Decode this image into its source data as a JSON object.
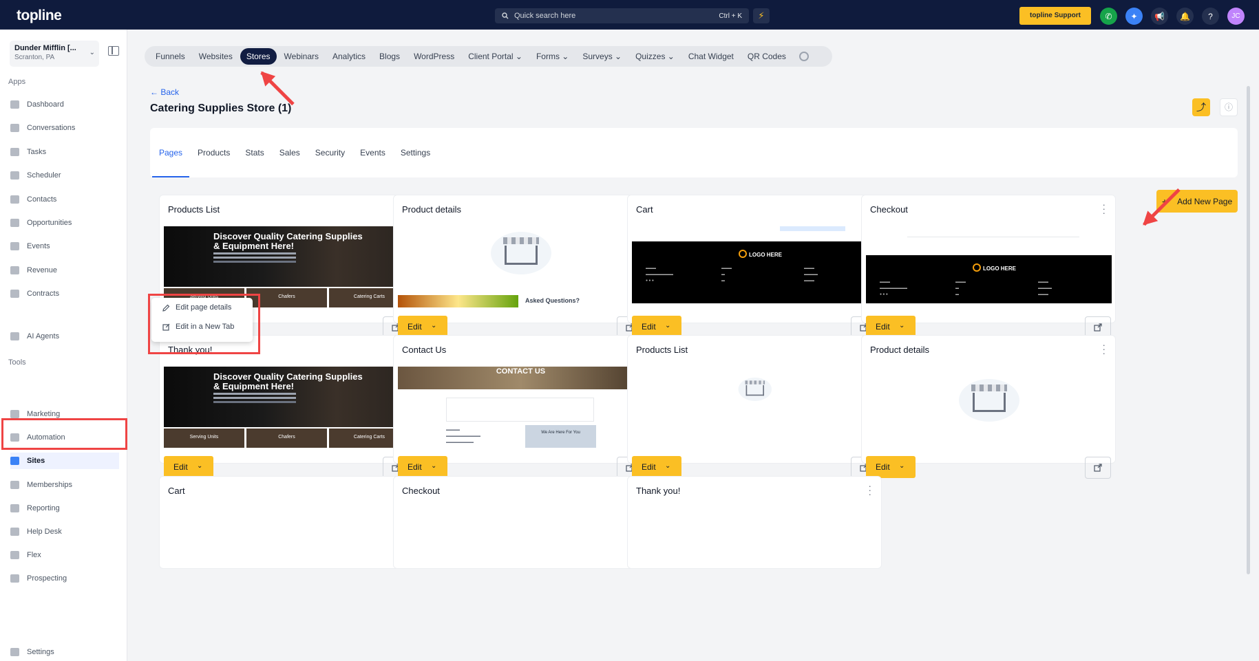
{
  "app": {
    "logo": "topline"
  },
  "topbar": {
    "search_placeholder": "Quick search here",
    "search_shortcut": "Ctrl + K",
    "support_label": "topline Support",
    "avatar_initials": "JC"
  },
  "account": {
    "name": "Dunder Mifflin [...",
    "location": "Scranton, PA"
  },
  "sidebar": {
    "apps_header": "Apps",
    "tools_header": "Tools",
    "apps": [
      {
        "label": "Dashboard",
        "icon": "dashboard-icon"
      },
      {
        "label": "Conversations",
        "icon": "conversations-icon"
      },
      {
        "label": "Tasks",
        "icon": "tasks-icon"
      },
      {
        "label": "Scheduler",
        "icon": "calendar-icon"
      },
      {
        "label": "Contacts",
        "icon": "contacts-icon"
      },
      {
        "label": "Opportunities",
        "icon": "opportunities-icon"
      },
      {
        "label": "Events",
        "icon": "events-icon"
      },
      {
        "label": "Revenue",
        "icon": "revenue-icon"
      },
      {
        "label": "Contracts",
        "icon": "contracts-icon"
      }
    ],
    "ai_agents": "AI Agents",
    "tools": [
      {
        "label": "Marketing",
        "icon": "marketing-icon"
      },
      {
        "label": "Automation",
        "icon": "automation-icon"
      },
      {
        "label": "Sites",
        "icon": "sites-icon",
        "active": true
      },
      {
        "label": "Memberships",
        "icon": "memberships-icon"
      },
      {
        "label": "Reporting",
        "icon": "reporting-icon"
      },
      {
        "label": "Help Desk",
        "icon": "helpdesk-icon"
      },
      {
        "label": "Flex",
        "icon": "flex-icon"
      },
      {
        "label": "Prospecting",
        "icon": "prospecting-icon"
      }
    ],
    "settings": "Settings"
  },
  "top_tabs": [
    "Funnels",
    "Websites",
    "Stores",
    "Webinars",
    "Analytics",
    "Blogs",
    "WordPress",
    "Client Portal",
    "Forms",
    "Surveys",
    "Quizzes",
    "Chat Widget",
    "QR Codes"
  ],
  "top_tabs_active": "Stores",
  "page": {
    "back": "← Back",
    "title": "Catering Supplies Store (1)",
    "subtabs": [
      "Pages",
      "Products",
      "Stats",
      "Sales",
      "Security",
      "Events",
      "Settings"
    ],
    "subtabs_active": "Pages",
    "add_button": "Add New Page"
  },
  "cards": [
    {
      "title": "Products List",
      "thumb": "hero"
    },
    {
      "title": "Product details",
      "thumb": "store-faq"
    },
    {
      "title": "Cart",
      "thumb": "dark-footer"
    },
    {
      "title": "Checkout",
      "thumb": "dark-footer-2"
    },
    {
      "title": "Thank you!",
      "thumb": "hero"
    },
    {
      "title": "Contact Us",
      "thumb": "contact"
    },
    {
      "title": "Products List",
      "thumb": "store-small"
    },
    {
      "title": "Product details",
      "thumb": "store"
    },
    {
      "title": "Cart",
      "thumb": "none"
    },
    {
      "title": "Checkout",
      "thumb": "none"
    },
    {
      "title": "Thank you!",
      "thumb": "none"
    }
  ],
  "card_labels": {
    "edit": "Edit"
  },
  "thumb_text": {
    "hero_title_1": "Discover Quality Catering Supplies",
    "hero_title_2": "& Equipment Here!",
    "tiles": [
      "Serving Units",
      "Chafers",
      "Catering Carts"
    ],
    "faq": "Asked Questions?",
    "logo": "LOGO HERE",
    "contact_heading": "CONTACT US",
    "contact_here": "We Are Here For You"
  },
  "context_menu": [
    "Edit page details",
    "Edit in a New Tab"
  ],
  "colors": {
    "accent": "#fbbf24",
    "nav": "#0f1b3d",
    "active_tab": "#111d42",
    "link": "#2563eb",
    "annotation": "#ef4444"
  }
}
